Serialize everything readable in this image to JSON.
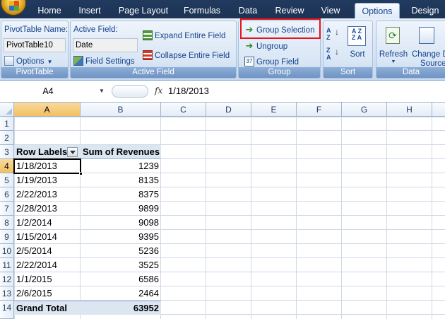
{
  "tabs": [
    {
      "label": "Home"
    },
    {
      "label": "Insert"
    },
    {
      "label": "Page Layout"
    },
    {
      "label": "Formulas"
    },
    {
      "label": "Data"
    },
    {
      "label": "Review"
    },
    {
      "label": "View"
    },
    {
      "label": "Options"
    },
    {
      "label": "Design"
    }
  ],
  "ribbon": {
    "pivottable": {
      "name_label": "PivotTable Name:",
      "name_value": "PivotTable10",
      "options_label": "Options",
      "group_title": "PivotTable"
    },
    "active_field": {
      "label": "Active Field:",
      "value": "Date",
      "field_settings": "Field Settings",
      "expand": "Expand Entire Field",
      "collapse": "Collapse Entire Field",
      "group_title": "Active Field"
    },
    "group": {
      "group_selection": "Group Selection",
      "ungroup": "Ungroup",
      "group_field": "Group Field",
      "group_title": "Group"
    },
    "sort": {
      "sort_label": "Sort",
      "group_title": "Sort"
    },
    "data": {
      "refresh": "Refresh",
      "change_source_line1": "Change D",
      "change_source_line2": "Source",
      "group_title": "Data"
    }
  },
  "formula_bar": {
    "name_box": "A4",
    "fx": "fx",
    "formula": "1/18/2013"
  },
  "columns": [
    "A",
    "B",
    "C",
    "D",
    "E",
    "F",
    "G",
    "H"
  ],
  "rows": [
    "1",
    "2",
    "3",
    "4",
    "5",
    "6",
    "7",
    "8",
    "9",
    "10",
    "11",
    "12",
    "13",
    "14"
  ],
  "pivot": {
    "header_label": "Row Labels",
    "header_value": "Sum of Revenues",
    "rows": [
      {
        "label": "1/18/2013",
        "value": "1239"
      },
      {
        "label": "1/19/2013",
        "value": "8135"
      },
      {
        "label": "2/22/2013",
        "value": "8375"
      },
      {
        "label": "2/28/2013",
        "value": "9899"
      },
      {
        "label": "1/2/2014",
        "value": "9098"
      },
      {
        "label": "1/15/2014",
        "value": "9395"
      },
      {
        "label": "2/5/2014",
        "value": "5236"
      },
      {
        "label": "2/22/2014",
        "value": "3525"
      },
      {
        "label": "1/1/2015",
        "value": "6586"
      },
      {
        "label": "2/6/2015",
        "value": "2464"
      }
    ],
    "total_label": "Grand Total",
    "total_value": "63952"
  },
  "colors": {
    "highlight": "#e8141c",
    "pivot_header": "#dce6f1",
    "selected_header": "#f1c15f"
  }
}
